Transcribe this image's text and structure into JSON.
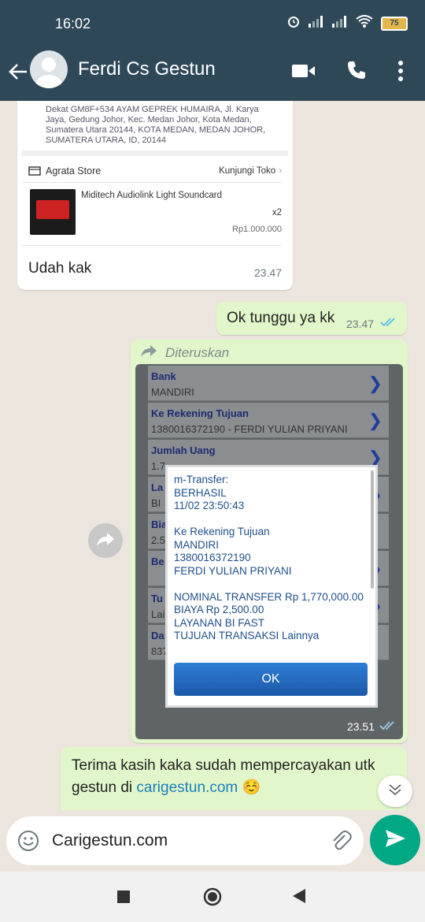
{
  "status_bar": {
    "time": "16:02",
    "battery": "75"
  },
  "header": {
    "contact_name": "Ferdi Cs Gestun"
  },
  "messages": {
    "order": {
      "address": "Dekat GM8F+534 AYAM GEPREK HUMAIRA, Jl. Karya Jaya, Gedung Johor, Kec. Medan Johor, Kota Medan, Sumatera Utara 20144, KOTA MEDAN, MEDAN JOHOR, SUMATERA UTARA, ID, 20144",
      "store_name": "Agrata Store",
      "visit_store": "Kunjungi Toko",
      "product_name": "Miditech Audiolink Light Soundcard",
      "quantity": "x2",
      "price": "Rp1.000.000",
      "caption": "Udah kak",
      "time": "23.47"
    },
    "reply1": {
      "text": "Ok tunggu ya kk",
      "time": "23.47"
    },
    "forwarded": {
      "label": "Diteruskan",
      "time": "23.51",
      "screenshot_rows": [
        {
          "key": "Bank",
          "value": "MANDIRI"
        },
        {
          "key": "Ke Rekening Tujuan",
          "value": "1380016372190 - FERDI YULIAN PRIYANI"
        },
        {
          "key": "Jumlah Uang",
          "value": "1.7"
        },
        {
          "key": "La",
          "value": "BI"
        },
        {
          "key": "Bia",
          "value": "2.5"
        },
        {
          "key": "Be",
          "value": ""
        },
        {
          "key": "Tu",
          "value": "Lai"
        },
        {
          "key": "Da",
          "value": "837"
        }
      ],
      "dialog_text": "m-Transfer:\nBERHASIL\n11/02 23:50:43\n\nKe Rekening Tujuan\nMANDIRI\n1380016372190\nFERDI YULIAN PRIYANI\n\nNOMINAL TRANSFER Rp 1,770,000.00\nBIAYA Rp 2,500.00\nLAYANAN BI FAST\nTUJUAN TRANSAKSI Lainnya",
      "dialog_button": "OK"
    },
    "reply2": {
      "text": "Terima kasih kaka sudah mempercayakan utk gestun di ",
      "link": "carigestun.com",
      "emoji": "☺️"
    }
  },
  "composer": {
    "value": "Carigestun.com"
  },
  "colors": {
    "header": "#2F4858",
    "outgoing": "#E1F7CB",
    "accent": "#00A884"
  }
}
